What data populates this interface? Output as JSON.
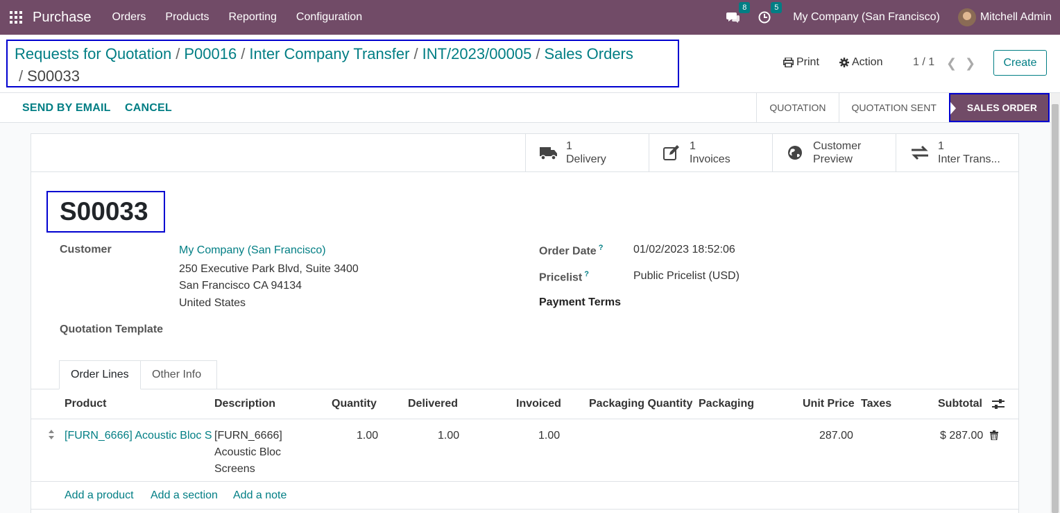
{
  "navbar": {
    "brand": "Purchase",
    "menus": [
      "Orders",
      "Products",
      "Reporting",
      "Configuration"
    ],
    "messages_count": "8",
    "activities_count": "5",
    "company": "My Company (San Francisco)",
    "user": "Mitchell Admin",
    "bg_color": "#714B67"
  },
  "breadcrumb": {
    "items": [
      "Requests for Quotation",
      "P00016",
      "Inter Company Transfer",
      "INT/2023/00005",
      "Sales Orders"
    ],
    "current": "S00033"
  },
  "control_panel": {
    "print_label": "Print",
    "action_label": "Action",
    "pager": "1 / 1",
    "create_label": "Create"
  },
  "statusbar": {
    "send_email_label": "SEND BY EMAIL",
    "cancel_label": "CANCEL",
    "stages": [
      "QUOTATION",
      "QUOTATION SENT",
      "SALES ORDER"
    ],
    "active_stage": "SALES ORDER"
  },
  "smart_buttons": [
    {
      "count": "1",
      "label": "Delivery",
      "icon": "truck-icon"
    },
    {
      "count": "1",
      "label": "Invoices",
      "icon": "edit-icon"
    },
    {
      "count": "Customer",
      "label": "Preview",
      "icon": "globe-icon"
    },
    {
      "count": "1",
      "label": "Inter Trans...",
      "icon": "exchange-icon"
    }
  ],
  "form": {
    "title": "S00033",
    "customer_label": "Customer",
    "customer_name": "My Company (San Francisco)",
    "address_line1": "250 Executive Park Blvd, Suite 3400",
    "address_line2": "San Francisco CA 94134",
    "address_line3": "United States",
    "quotation_template_label": "Quotation Template",
    "order_date_label": "Order Date",
    "order_date": "01/02/2023 18:52:06",
    "pricelist_label": "Pricelist",
    "pricelist": "Public Pricelist (USD)",
    "payment_terms_label": "Payment Terms",
    "help_mark": "?"
  },
  "tabs": [
    "Order Lines",
    "Other Info"
  ],
  "table": {
    "headers": [
      "Product",
      "Description",
      "Quantity",
      "Delivered",
      "Invoiced",
      "Packaging Quantity",
      "Packaging",
      "Unit Price",
      "Taxes",
      "Subtotal"
    ],
    "rows": [
      {
        "product": "[FURN_6666] Acoustic Bloc S",
        "description_1": "[FURN_6666]",
        "description_2": "Acoustic Bloc",
        "description_3": "Screens",
        "quantity": "1.00",
        "delivered": "1.00",
        "invoiced": "1.00",
        "unit_price": "287.00",
        "subtotal": "$ 287.00"
      }
    ],
    "add_product": "Add a product",
    "add_section": "Add a section",
    "add_note": "Add a note"
  }
}
